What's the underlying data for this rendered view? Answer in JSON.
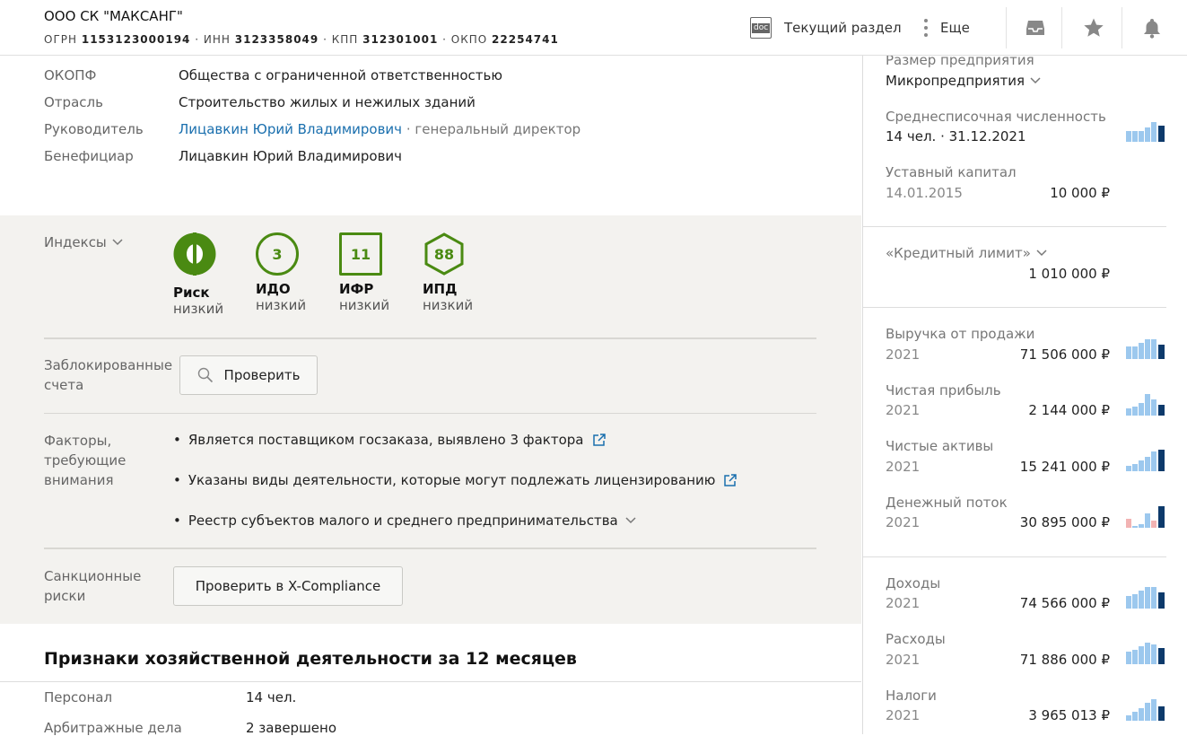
{
  "header": {
    "company_name": "ООО СК \"МАКСАНГ\"",
    "ogrn_label": "ОГРН",
    "ogrn": "1153123000194",
    "inn_label": "ИНН",
    "inn": "3123358049",
    "kpp_label": "КПП",
    "kpp": "312301001",
    "okpo_label": "ОКПО",
    "okpo": "22254741",
    "sep": "·",
    "current_section": "Текущий раздел",
    "more": "Еще",
    "doc_icon_text": "doc"
  },
  "details": [
    {
      "key": "ОКОПФ",
      "value": "Общества с ограниченной ответственностью"
    },
    {
      "key": "Отрасль",
      "value": "Строительство жилых и нежилых зданий"
    },
    {
      "key": "Руководитель",
      "value": "Лицавкин Юрий Владимирович",
      "extra": " · генеральный директор"
    },
    {
      "key": "Бенефициар",
      "value": "Лицавкин Юрий Владимирович"
    }
  ],
  "indexes": {
    "label": "Индексы",
    "items": [
      {
        "symbol": "",
        "title": "Риск",
        "status": "низкий"
      },
      {
        "symbol": "3",
        "title": "ИДО",
        "status": "низкий"
      },
      {
        "symbol": "11",
        "title": "ИФР",
        "status": "низкий"
      },
      {
        "symbol": "88",
        "title": "ИПД",
        "status": "низкий"
      }
    ],
    "accent": "#4a8a12"
  },
  "blocked": {
    "label_line1": "Заблокированные",
    "label_line2": "счета",
    "button": "Проверить"
  },
  "factors": {
    "label_line1": "Факторы,",
    "label_line2": "требующие",
    "label_line3": "внимания",
    "items": [
      "Является поставщиком госзаказа, выявлено 3 фактора",
      "Указаны виды деятельности, которые могут подлежать лицензированию",
      "Реестр субъектов малого и среднего предпринимательства"
    ]
  },
  "sanctions": {
    "label_line1": "Санкционные",
    "label_line2": "риски",
    "button": "Проверить в X-Compliance"
  },
  "activity": {
    "title": "Признаки хозяйственной деятельности за 12 месяцев",
    "rows": [
      {
        "key": "Персонал",
        "value": "14 чел."
      },
      {
        "key": "Арбитражные дела",
        "value": "2 завершено"
      }
    ]
  },
  "right": {
    "size_label": "Размер предприятия",
    "size_value": "Микропредприятия",
    "staff_label": "Среднесписочная численность",
    "staff_value": "14 чел. · 31.12.2021",
    "capital_label": "Уставный капитал",
    "capital_date": "14.01.2015",
    "capital_value": "10 000 ₽",
    "credit_label": "«Кредитный лимит»",
    "credit_value": "1 010 000 ₽",
    "finance": [
      {
        "label": "Выручка от продажи",
        "year": "2021",
        "value": "71 506 000 ₽"
      },
      {
        "label": "Чистая прибыль",
        "year": "2021",
        "value": "2 144 000 ₽"
      },
      {
        "label": "Чистые активы",
        "year": "2021",
        "value": "15 241 000 ₽"
      },
      {
        "label": "Денежный поток",
        "year": "2021",
        "value": "30 895 000 ₽"
      }
    ],
    "tax": [
      {
        "label": "Доходы",
        "year": "2021",
        "value": "74 566 000 ₽"
      },
      {
        "label": "Расходы",
        "year": "2021",
        "value": "71 886 000 ₽"
      },
      {
        "label": "Налоги",
        "year": "2021",
        "value": "3 965 013 ₽"
      }
    ]
  },
  "colors": {
    "link": "#1a6fae",
    "green": "#4a8a12",
    "bar_light": "#9cc8ee",
    "bar_dark": "#0d3a6b",
    "bar_neg": "#f2b3b3"
  }
}
